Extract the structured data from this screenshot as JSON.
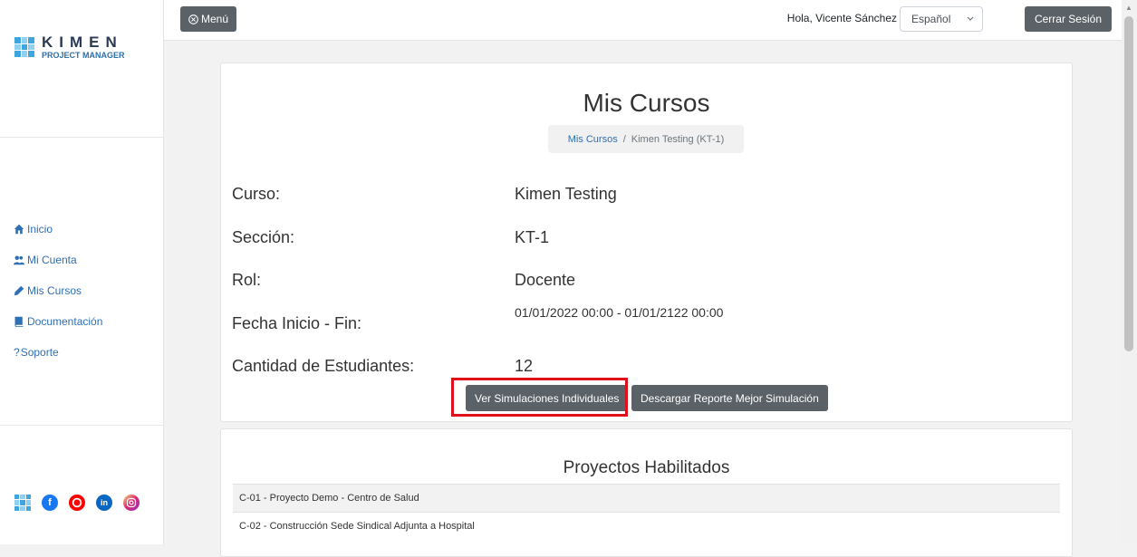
{
  "brand": {
    "name": "KIMEN",
    "subtitle": "PROJECT MANAGER"
  },
  "sidebar": {
    "items": [
      {
        "label": "Inicio",
        "icon": "home-icon"
      },
      {
        "label": "Mi Cuenta",
        "icon": "users-icon"
      },
      {
        "label": "Mis Cursos",
        "icon": "pencil-icon"
      },
      {
        "label": "Documentación",
        "icon": "book-icon"
      },
      {
        "label": "Soporte",
        "icon": "question-icon"
      }
    ],
    "social": [
      {
        "icon": "kimen-logo-icon"
      },
      {
        "icon": "facebook-icon",
        "letter": "f",
        "color": "#1877f2"
      },
      {
        "icon": "youtube-icon",
        "color": "#ff0000"
      },
      {
        "icon": "linkedin-icon",
        "letter": "in",
        "color": "#0a66c2"
      },
      {
        "icon": "instagram-icon",
        "color": "#e1306c"
      }
    ]
  },
  "topbar": {
    "menu_label": "Menú",
    "greeting": "Hola, Vicente Sánchez",
    "language": "Español",
    "logout_label": "Cerrar Sesión"
  },
  "main": {
    "title": "Mis Cursos",
    "breadcrumb": {
      "link": "Mis Cursos",
      "separator": "/",
      "current": "Kimen Testing (KT-1)"
    },
    "info": [
      {
        "label": "Curso:",
        "value": "Kimen Testing"
      },
      {
        "label": "Sección:",
        "value": "KT-1"
      },
      {
        "label": "Rol:",
        "value": "Docente"
      },
      {
        "label": "Fecha Inicio - Fin:",
        "value": "01/01/2022 00:00 - 01/01/2122 00:00"
      },
      {
        "label": "Cantidad de Estudiantes:",
        "value": "12"
      }
    ],
    "buttons": {
      "simulations": "Ver Simulaciones Individuales",
      "report": "Descargar Reporte Mejor Simulación"
    }
  },
  "projects": {
    "title": "Proyectos Habilitados",
    "items": [
      "C-01 - Proyecto Demo - Centro de Salud",
      "C-02 - Construcción Sede Sindical Adjunta a Hospital"
    ]
  },
  "colors": {
    "accent": "#2f6fb3",
    "button_dark": "#5a6268",
    "highlight": "#e0101a"
  }
}
